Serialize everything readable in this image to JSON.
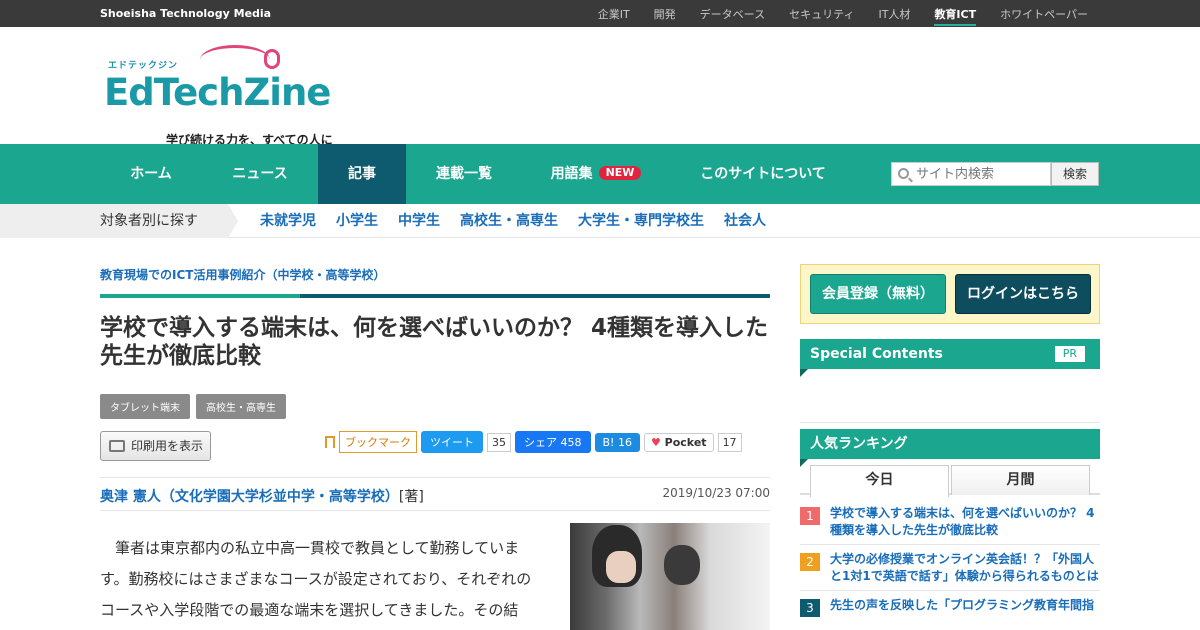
{
  "topbar": {
    "brand": "Shoeisha Technology Media",
    "sites": [
      "企業IT",
      "開発",
      "データベース",
      "セキュリティ",
      "IT人材",
      "教育ICT",
      "ホワイトペーパー"
    ],
    "active_site": "教育ICT"
  },
  "logo": {
    "kana": "エドテックジン",
    "wordmark": "EdTechZine",
    "tagline": "学び続ける力を、すべての人に"
  },
  "nav": {
    "items": [
      "ホーム",
      "ニュース",
      "記事",
      "連載一覧",
      "用語集",
      "このサイトについて"
    ],
    "active": "記事",
    "new_badge": "NEW",
    "search_placeholder": "サイト内検索",
    "search_button": "検索"
  },
  "subnav": {
    "lead": "対象者別に探す",
    "links": [
      "未就学児",
      "小学生",
      "中学生",
      "高校生・高専生",
      "大学生・専門学校生",
      "社会人"
    ]
  },
  "article": {
    "series": "教育現場でのICT活用事例紹介（中学校・高等学校）",
    "title": "学校で導入する端末は、何を選べばいいのか？ 4種類を導入した先生が徹底比較",
    "tags": [
      "タブレット端末",
      "高校生・高専生"
    ],
    "print_label": "印刷用を表示",
    "social": {
      "bookmark": "ブックマーク",
      "tweet": "ツイート",
      "tweet_count": "35",
      "facebook": "シェア 458",
      "hatena": "16",
      "pocket": "Pocket",
      "pocket_count": "17"
    },
    "author": "奥津 憲人（文化学園大学杉並中学・高等学校）",
    "author_role": "[著]",
    "date": "2019/10/23 07:00",
    "body": "　筆者は東京都内の私立中高一貫校で教員として勤務しています。勤務校にはさまざまなコースが設定されており、それぞれのコースや入学段階での最適な端末を選択してきました。その結果、現在では他に類を見ないほどの複数の端末を扱う学校になり"
  },
  "sidebar": {
    "register": "会員登録（無料）",
    "login": "ログインはこちら",
    "special_title": "Special Contents",
    "pr": "PR",
    "ranking_title": "人気ランキング",
    "tab_today": "今日",
    "tab_month": "月間",
    "ranking": [
      {
        "rank": "1",
        "title": "学校で導入する端末は、何を選べばいいのか？ 4種類を導入した先生が徹底比較"
      },
      {
        "rank": "2",
        "title": "大学の必修授業でオンライン英会話！？「外国人と1対1で英語で話す」体験から得られるものとは"
      },
      {
        "rank": "3",
        "title": "先生の声を反映した「プログラミング教育年間指"
      }
    ]
  },
  "colors": {
    "accent": "#1aa68f",
    "accent_dark": "#0e5a6e",
    "link": "#1a6db8",
    "badge": "#e0243e"
  }
}
